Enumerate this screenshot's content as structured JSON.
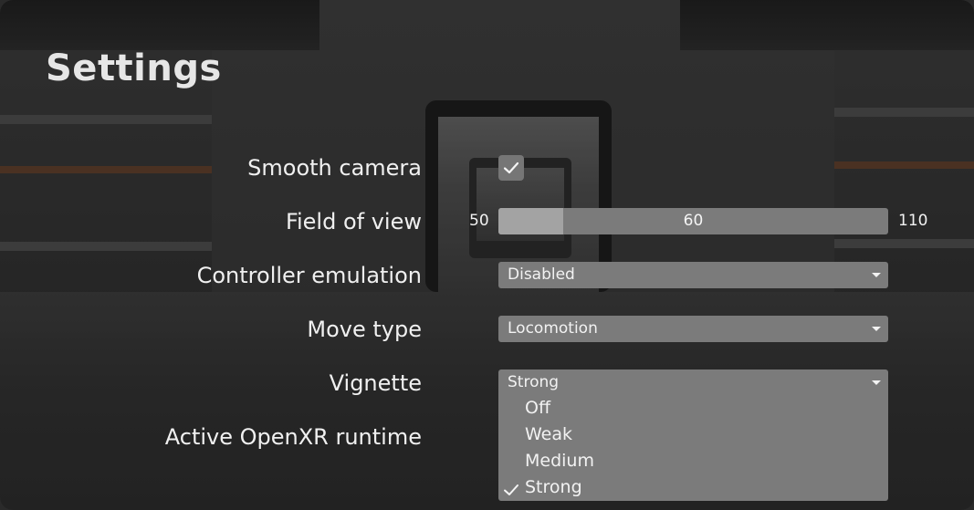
{
  "title": "Settings",
  "settings": {
    "smooth_camera": {
      "label": "Smooth camera",
      "checked": true,
      "icon": "check-icon"
    },
    "field_of_view": {
      "label": "Field of view",
      "min": "50",
      "max": "110",
      "value": "60",
      "fraction": 0.1667
    },
    "controller_emulation": {
      "label": "Controller emulation",
      "value": "Disabled"
    },
    "move_type": {
      "label": "Move type",
      "value": "Locomotion"
    },
    "vignette": {
      "label": "Vignette",
      "value": "Strong",
      "options": [
        "Off",
        "Weak",
        "Medium",
        "Strong"
      ],
      "selected_index": 3
    },
    "openxr_runtime": {
      "label": "Active OpenXR runtime"
    }
  },
  "colors": {
    "control_bg": "#7b7b7b",
    "slider_fill": "#a3a3a3",
    "text": "#f0f0f0"
  }
}
